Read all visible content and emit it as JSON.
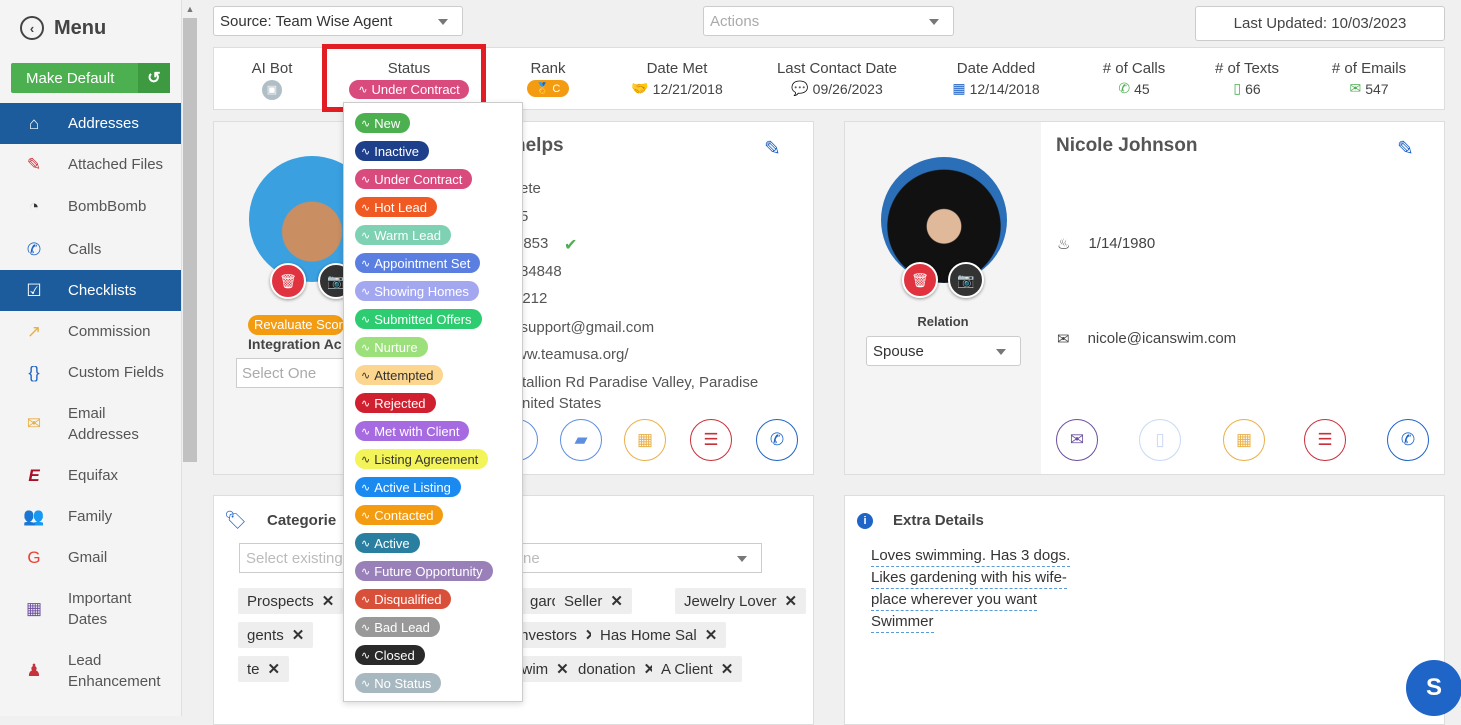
{
  "sidebar": {
    "title": "Menu",
    "make_default": "Make Default",
    "items": [
      {
        "label": "Addresses",
        "icon": "home-icon",
        "active": true
      },
      {
        "label": "Attached Files",
        "icon": "paperclip-icon",
        "active": false
      },
      {
        "label": "BombBomb",
        "icon": "bombbomb-icon",
        "active": false
      },
      {
        "label": "Calls",
        "icon": "phone-icon",
        "active": false
      },
      {
        "label": "Checklists",
        "icon": "checkbox-icon",
        "active": true
      },
      {
        "label": "Commission",
        "icon": "chart-icon",
        "active": false
      },
      {
        "label": "Custom Fields",
        "icon": "braces-icon",
        "active": false
      },
      {
        "label": "Email Addresses",
        "icon": "envelope-open-icon",
        "active": false
      },
      {
        "label": "Equifax",
        "icon": "equifax-icon",
        "active": false
      },
      {
        "label": "Family",
        "icon": "users-icon",
        "active": false
      },
      {
        "label": "Gmail",
        "icon": "google-icon",
        "active": false
      },
      {
        "label": "Important Dates",
        "icon": "calendar-icon",
        "active": false
      },
      {
        "label": "Lead Enhancement",
        "icon": "person-icon",
        "active": false
      }
    ]
  },
  "topbar": {
    "source": "Source: Team Wise Agent",
    "actions_placeholder": "Actions",
    "last_updated": "Last Updated: 10/03/2023"
  },
  "stats": {
    "ai_bot": "AI Bot",
    "status_label": "Status",
    "status_value": "Under Contract",
    "rank_label": "Rank",
    "rank_value": "C",
    "date_met_label": "Date Met",
    "date_met": "12/21/2018",
    "last_contact_label": "Last Contact Date",
    "last_contact": "09/26/2023",
    "date_added_label": "Date Added",
    "date_added": "12/14/2018",
    "calls_label": "# of Calls",
    "calls": "45",
    "texts_label": "# of Texts",
    "texts": "66",
    "emails_label": "# of Emails",
    "emails": "547"
  },
  "contact": {
    "name_partial": "helps",
    "evaluate_score": "Revaluate Scor",
    "integration_label": "Integration Ac",
    "integration_placeholder": "Select One",
    "details": [
      "ete",
      "5",
      "-8853",
      "84848",
      "1212",
      "ntsupport@gmail.com",
      "ww.teamusa.org/",
      "tallion Rd Paradise Valley, Paradise",
      "nited States"
    ]
  },
  "spouse": {
    "name": "Nicole Johnson",
    "birthday": "1/14/1980",
    "email": "nicole@icanswim.com",
    "relation_label": "Relation",
    "relation_value": "Spouse"
  },
  "categories": {
    "title": "Categorie",
    "placeholder_left": "Select existing",
    "placeholder_right": "ne",
    "tags": [
      "Prospects",
      "gardening",
      "Seller",
      "Jewelry Lover",
      "gents",
      "Investors",
      "Has Home Sal",
      "te",
      "swim",
      "donation",
      "A Client"
    ]
  },
  "extra": {
    "title": "Extra Details",
    "lines": [
      "Loves swimming. Has 3 dogs.",
      "Likes gardening with his wife-",
      "place wherever you want",
      "Swimmer"
    ]
  },
  "status_options": [
    {
      "label": "New",
      "color": "#4caf50"
    },
    {
      "label": "Inactive",
      "color": "#1e3f8a"
    },
    {
      "label": "Under Contract",
      "color": "#d94b7d"
    },
    {
      "label": "Hot Lead",
      "color": "#f05a22"
    },
    {
      "label": "Warm Lead",
      "color": "#7fd1b3"
    },
    {
      "label": "Appointment Set",
      "color": "#5b7fe0"
    },
    {
      "label": "Showing Homes",
      "color": "#a3a7f0"
    },
    {
      "label": "Submitted Offers",
      "color": "#2ecc71"
    },
    {
      "label": "Nurture",
      "color": "#9be07a"
    },
    {
      "label": "Attempted",
      "color": "#fcd58e"
    },
    {
      "label": "Rejected",
      "color": "#d0202f"
    },
    {
      "label": "Met with Client",
      "color": "#a66be0"
    },
    {
      "label": "Listing Agreement",
      "color": "#f3f35a"
    },
    {
      "label": "Active Listing",
      "color": "#1a8af0"
    },
    {
      "label": "Contacted",
      "color": "#f39c12"
    },
    {
      "label": "Active",
      "color": "#2a7fa0"
    },
    {
      "label": "Future Opportunity",
      "color": "#9a80b8"
    },
    {
      "label": "Disqualified",
      "color": "#d9503a"
    },
    {
      "label": "Bad Lead",
      "color": "#999999"
    },
    {
      "label": "Closed",
      "color": "#2a2a2a"
    },
    {
      "label": "No Status",
      "color": "#a8b8c0"
    }
  ]
}
